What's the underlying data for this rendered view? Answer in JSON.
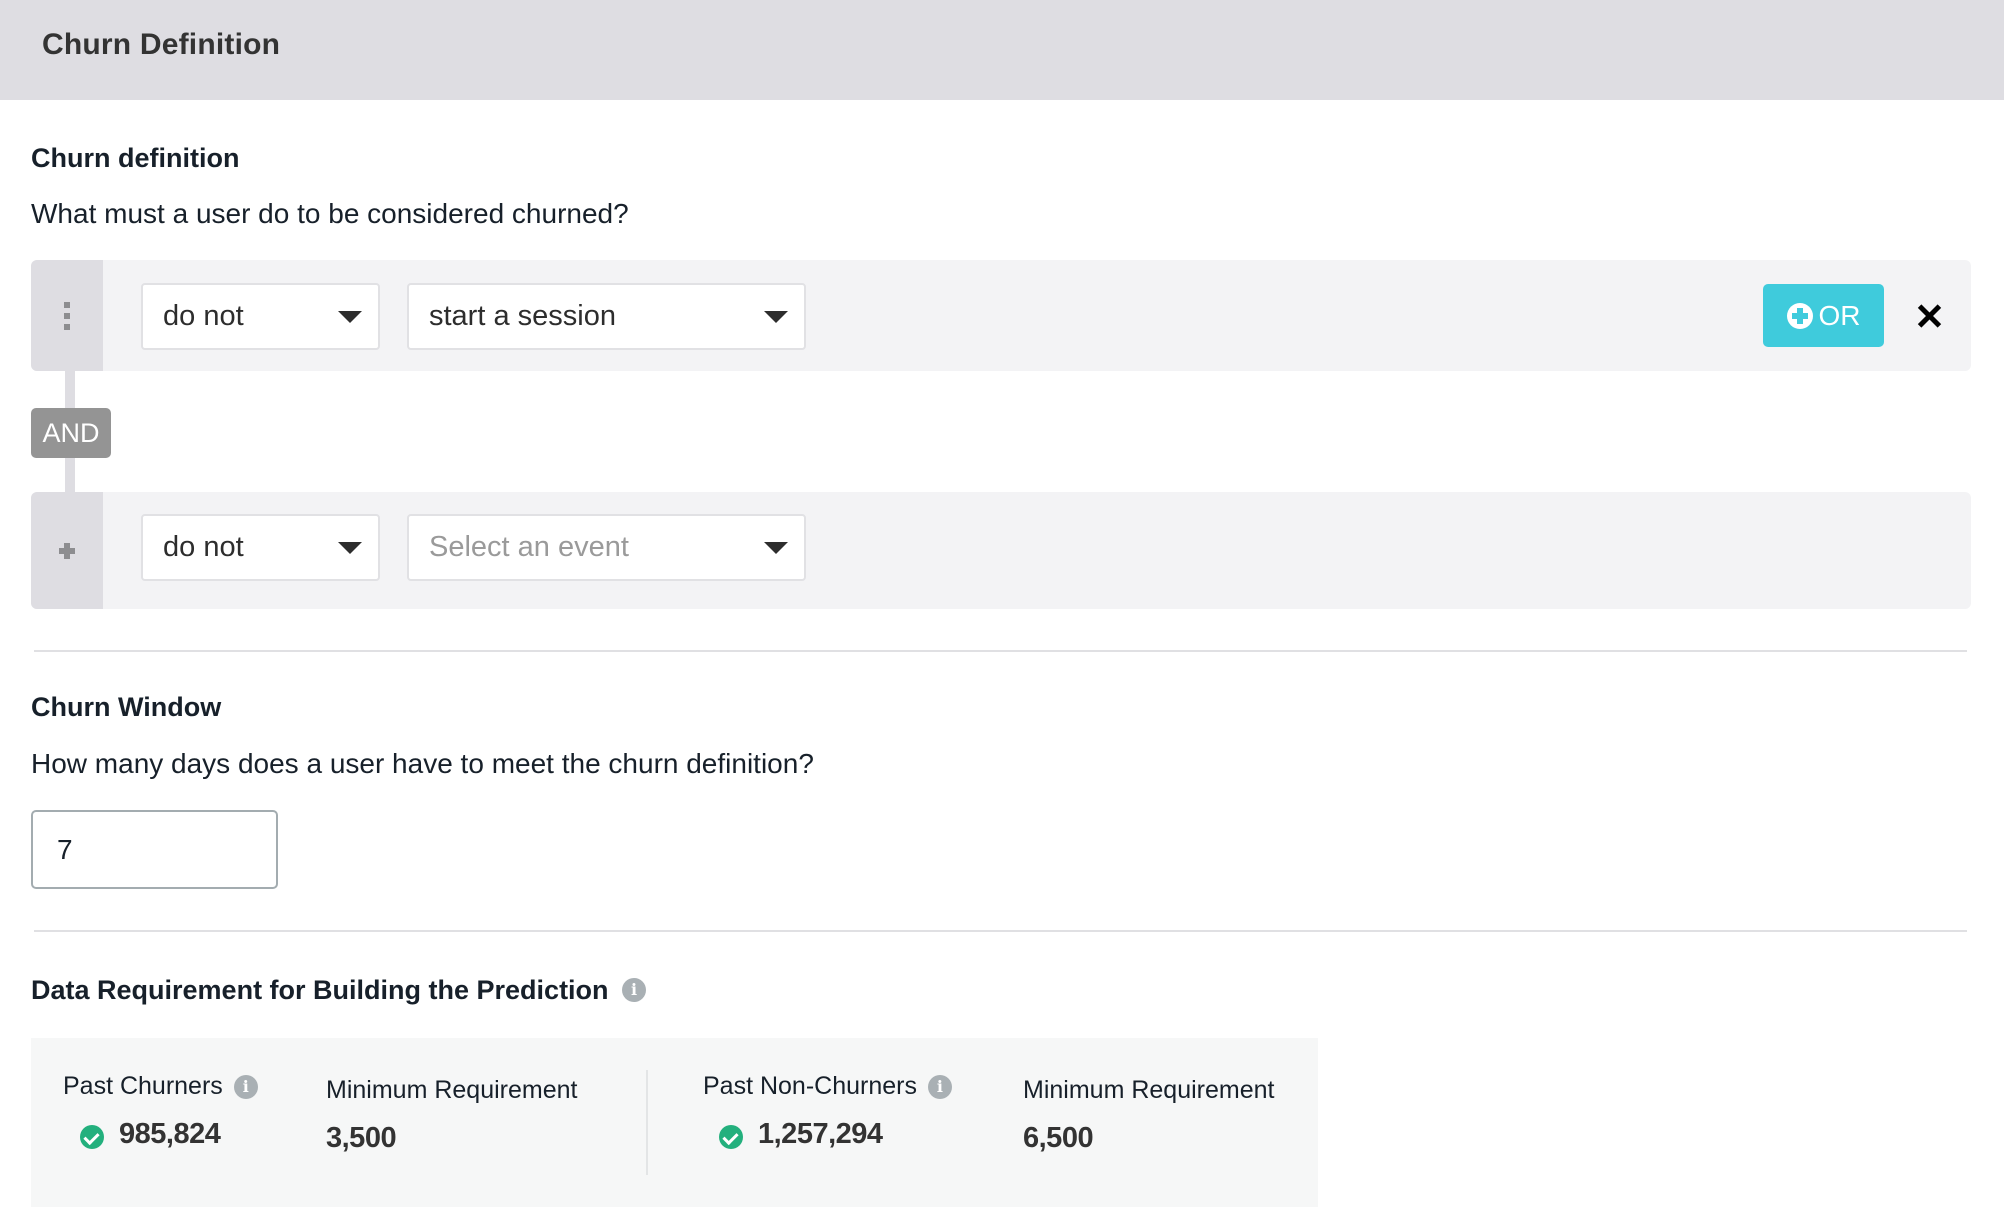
{
  "header": {
    "title": "Churn Definition"
  },
  "churn_definition": {
    "heading": "Churn definition",
    "question": "What must a user do to be considered churned?",
    "connector_label": "AND",
    "rows": [
      {
        "handle_icon": "drag-handle-icon",
        "condition": "do not",
        "event": "start a session",
        "event_placeholder": "",
        "or_button_label": "OR",
        "remove_icon": "close-icon"
      },
      {
        "handle_icon": "plus-icon",
        "condition": "do not",
        "event": "",
        "event_placeholder": "Select an event"
      }
    ]
  },
  "churn_window": {
    "heading": "Churn Window",
    "question": "How many days does a user have to meet the churn definition?",
    "days_value": "7"
  },
  "data_requirement": {
    "heading": "Data Requirement for Building the Prediction",
    "info_icon": "i",
    "churners": {
      "label": "Past Churners",
      "value": "985,824",
      "status": "met",
      "min_label": "Minimum Requirement",
      "min_value": "3,500"
    },
    "non_churners": {
      "label": "Past Non-Churners",
      "value": "1,257,294",
      "status": "met",
      "min_label": "Minimum Requirement",
      "min_value": "6,500"
    }
  },
  "colors": {
    "accent": "#3fcbdc",
    "success": "#23b07d",
    "header_bg": "#dedde2",
    "badge_bg": "#949494"
  }
}
